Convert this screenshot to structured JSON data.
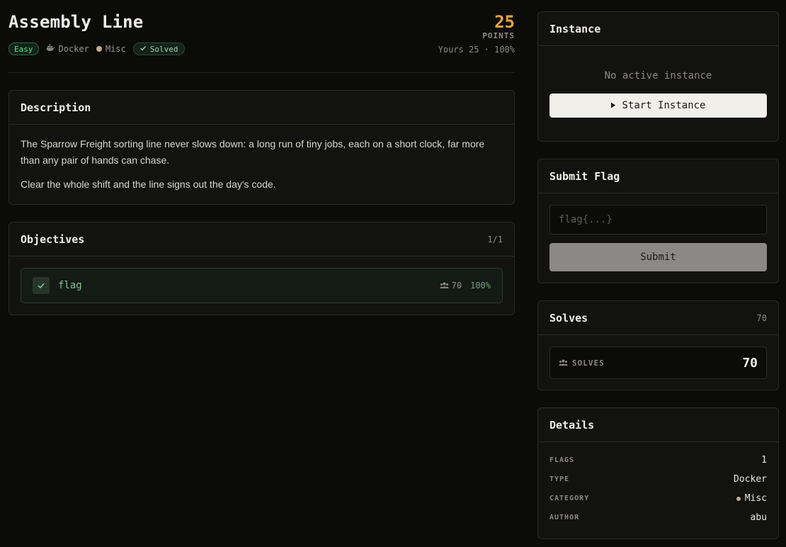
{
  "challenge": {
    "title": "Assembly Line",
    "difficulty": "Easy",
    "type": "Docker",
    "category": "Misc",
    "status": "Solved",
    "points": "25",
    "points_label": "POINTS",
    "yours": "Yours 25 · 100%"
  },
  "description": {
    "heading": "Description",
    "paragraphs": [
      "The Sparrow Freight sorting line never slows down: a long run of tiny jobs, each on a short clock, far more than any pair of hands can chase.",
      "Clear the whole shift and the line signs out the day's code."
    ]
  },
  "objectives": {
    "heading": "Objectives",
    "count": "1/1",
    "items": [
      {
        "name": "flag",
        "solves": "70",
        "percent": "100%"
      }
    ]
  },
  "instance": {
    "heading": "Instance",
    "empty_text": "No active instance",
    "start_label": "Start Instance"
  },
  "submit": {
    "heading": "Submit Flag",
    "placeholder": "flag{...}",
    "value": "",
    "submit_label": "Submit"
  },
  "solves": {
    "heading": "Solves",
    "count": "70",
    "label": "SOLVES",
    "value": "70"
  },
  "details": {
    "heading": "Details",
    "rows": [
      {
        "key": "FLAGS",
        "value": "1"
      },
      {
        "key": "TYPE",
        "value": "Docker"
      },
      {
        "key": "CATEGORY",
        "value": "Misc"
      },
      {
        "key": "AUTHOR",
        "value": "abu"
      }
    ]
  },
  "colors": {
    "accent_points": "#e9a23b",
    "easy_green": "#6ddc8a",
    "category_dot": "#c9a98a",
    "solved_green": "#7fc594"
  },
  "icons": {
    "type": "docker-icon",
    "solved": "check-icon",
    "solves": "users-icon",
    "start": "play-icon"
  }
}
